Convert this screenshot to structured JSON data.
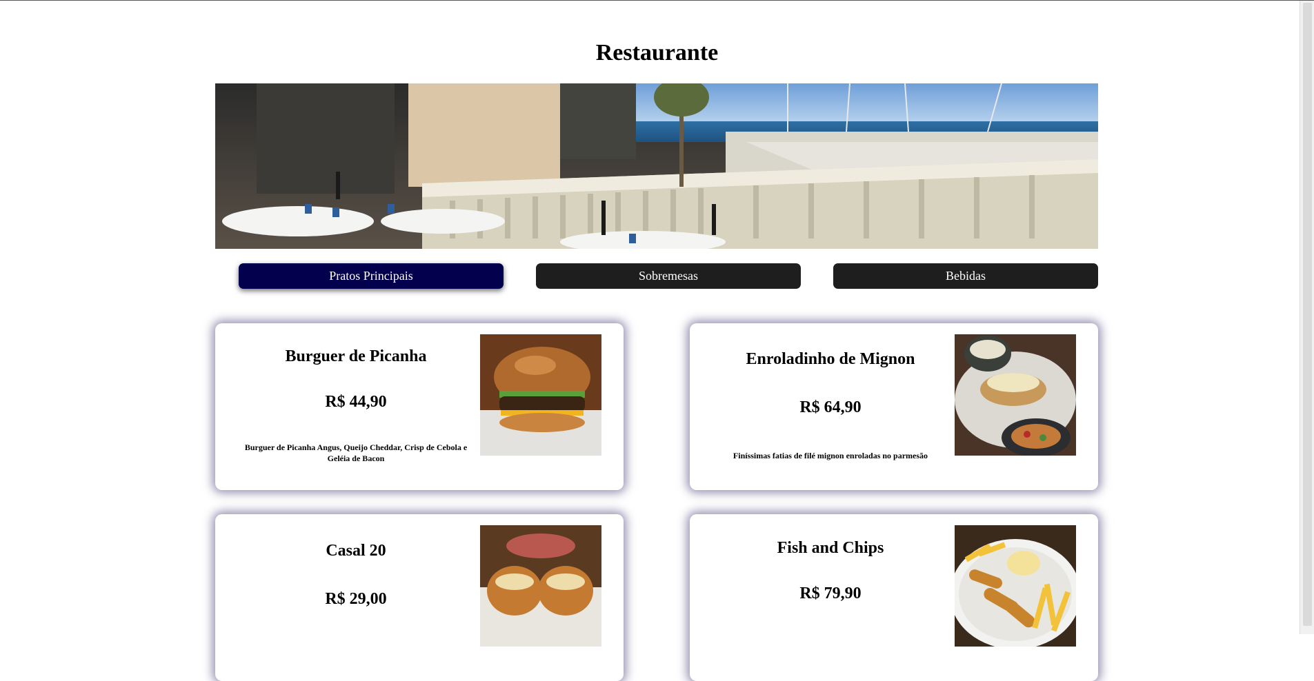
{
  "page": {
    "title": "Restaurante"
  },
  "tabs": [
    {
      "label": "Pratos Principais",
      "active": true
    },
    {
      "label": "Sobremesas",
      "active": false
    },
    {
      "label": "Bebidas",
      "active": false
    }
  ],
  "menu": {
    "items": [
      {
        "name": "Burguer de Picanha",
        "price": "R$ 44,90",
        "description": "Burguer de Picanha Angus, Queijo Cheddar, Crisp de Cebola e Geléia de Bacon"
      },
      {
        "name": "Enroladinho de Mignon",
        "price": "R$ 64,90",
        "description": "Finíssimas fatias de filé mignon enroladas no parmesão"
      },
      {
        "name": "Casal 20",
        "price": "R$ 29,00",
        "description": ""
      },
      {
        "name": "Fish and Chips",
        "price": "R$ 79,90",
        "description": ""
      }
    ]
  },
  "colors": {
    "active_tab": "#03014e",
    "inactive_tab": "#1e1e1e",
    "card_shadow": "#3c346e"
  }
}
